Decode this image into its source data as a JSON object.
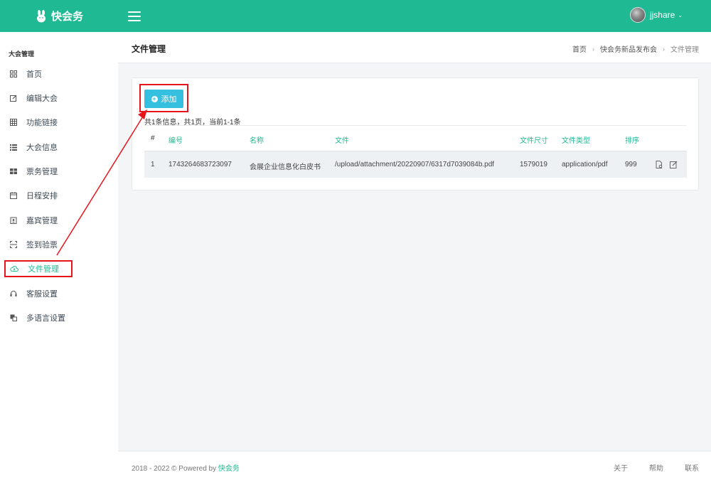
{
  "header": {
    "brand": "快会务",
    "user_name": "jjshare"
  },
  "sidebar": {
    "section_title": "大会管理",
    "items": [
      {
        "label": "首页",
        "icon": "dashboard-icon"
      },
      {
        "label": "编辑大会",
        "icon": "edit-icon"
      },
      {
        "label": "功能链接",
        "icon": "grid-icon"
      },
      {
        "label": "大会信息",
        "icon": "list-icon"
      },
      {
        "label": "票务管理",
        "icon": "ticket-icon"
      },
      {
        "label": "日程安排",
        "icon": "calendar-icon"
      },
      {
        "label": "嘉宾管理",
        "icon": "badge-icon"
      },
      {
        "label": "签到验票",
        "icon": "scan-icon"
      },
      {
        "label": "文件管理",
        "icon": "cloud-upload-icon",
        "active": true
      },
      {
        "label": "客服设置",
        "icon": "headset-icon"
      },
      {
        "label": "多语言设置",
        "icon": "translate-icon"
      }
    ]
  },
  "page": {
    "title": "文件管理",
    "breadcrumb": [
      "首页",
      "快会务新品发布会",
      "文件管理"
    ]
  },
  "toolbar": {
    "add_label": "添加"
  },
  "table": {
    "summary": "共1条信息，共1页，当前1-1条",
    "columns": [
      "#",
      "编号",
      "名称",
      "文件",
      "文件尺寸",
      "文件类型",
      "排序"
    ],
    "rows": [
      {
        "index": "1",
        "id": "1743264683723097",
        "name": "会展企业信息化白皮书",
        "file": "/upload/attachment/20220907/6317d7039084b.pdf",
        "size": "1579019",
        "type": "application/pdf",
        "sort": "999"
      }
    ]
  },
  "footer": {
    "copyright_prefix": "2018 - 2022 © Powered by ",
    "powered_by": "快会务",
    "links": [
      "关于",
      "帮助",
      "联系"
    ]
  },
  "colors": {
    "brand": "#1fb993",
    "add_button": "#35c0e0",
    "annotation_red": "#e8141c"
  }
}
